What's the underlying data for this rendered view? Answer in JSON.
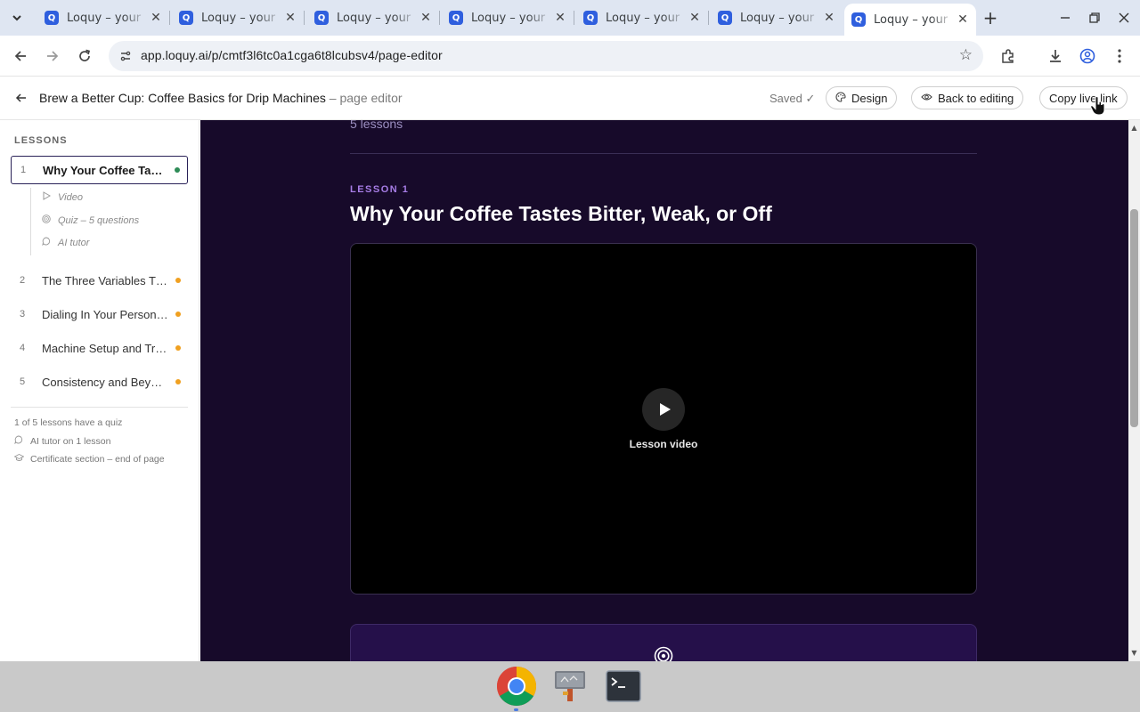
{
  "browser": {
    "tabs": [
      {
        "title": "Loquy – your",
        "favicon": "Q",
        "active": false
      },
      {
        "title": "Loquy – your",
        "favicon": "Q",
        "active": false
      },
      {
        "title": "Loquy – your",
        "favicon": "Q",
        "active": false
      },
      {
        "title": "Loquy – your",
        "favicon": "Q",
        "active": false
      },
      {
        "title": "Loquy – your",
        "favicon": "Q",
        "active": false
      },
      {
        "title": "Loquy – your",
        "favicon": "Q",
        "active": false
      },
      {
        "title": "Loquy – your",
        "favicon": "Q",
        "active": true
      }
    ],
    "url": "app.loquy.ai/p/cmtf3l6tc0a1cga6t8lcubsv4/page-editor",
    "accent": "#2f5fde"
  },
  "header": {
    "title": "Brew a Better Cup: Coffee Basics for Drip Machines",
    "subtitle": " – page editor",
    "saved": "Saved ✓",
    "design_label": "Design",
    "back_label": "Back to editing",
    "copy_label": "Copy live link"
  },
  "sidebar": {
    "heading": "LESSONS",
    "lessons": [
      {
        "num": "1",
        "title": "Why Your Coffee Tastes Bitter, Weak, or Off",
        "status_color": "#2e8b57"
      },
      {
        "num": "2",
        "title": "The Three Variables That Matter",
        "status_color": "#f0a020"
      },
      {
        "num": "3",
        "title": "Dialing In Your Personal Recipe",
        "status_color": "#f0a020"
      },
      {
        "num": "4",
        "title": "Machine Setup and Troubleshooting",
        "status_color": "#f0a020"
      },
      {
        "num": "5",
        "title": "Consistency and Beyond",
        "status_color": "#f0a020"
      }
    ],
    "subitems": [
      {
        "icon": "play-icon",
        "label": "Video"
      },
      {
        "icon": "target-icon",
        "label": "Quiz – 5 questions"
      },
      {
        "icon": "chat-icon",
        "label": "AI tutor"
      }
    ],
    "stats": [
      {
        "icon": "",
        "text": "1 of 5 lessons have a quiz"
      },
      {
        "icon": "chat-icon",
        "text": "AI tutor on 1 lesson"
      },
      {
        "icon": "graduation-cap-icon",
        "text": "Certificate section – end of page"
      }
    ]
  },
  "main": {
    "lesson_count": "5 lessons",
    "eyebrow": "LESSON 1",
    "title": "Why Your Coffee Tastes Bitter, Weak, or Off",
    "video_label": "Lesson video",
    "background": "#170a2a"
  },
  "taskbar": {
    "apps": [
      {
        "icon": "chrome-icon"
      },
      {
        "icon": "file-manager-icon"
      },
      {
        "icon": "terminal-icon"
      }
    ]
  }
}
